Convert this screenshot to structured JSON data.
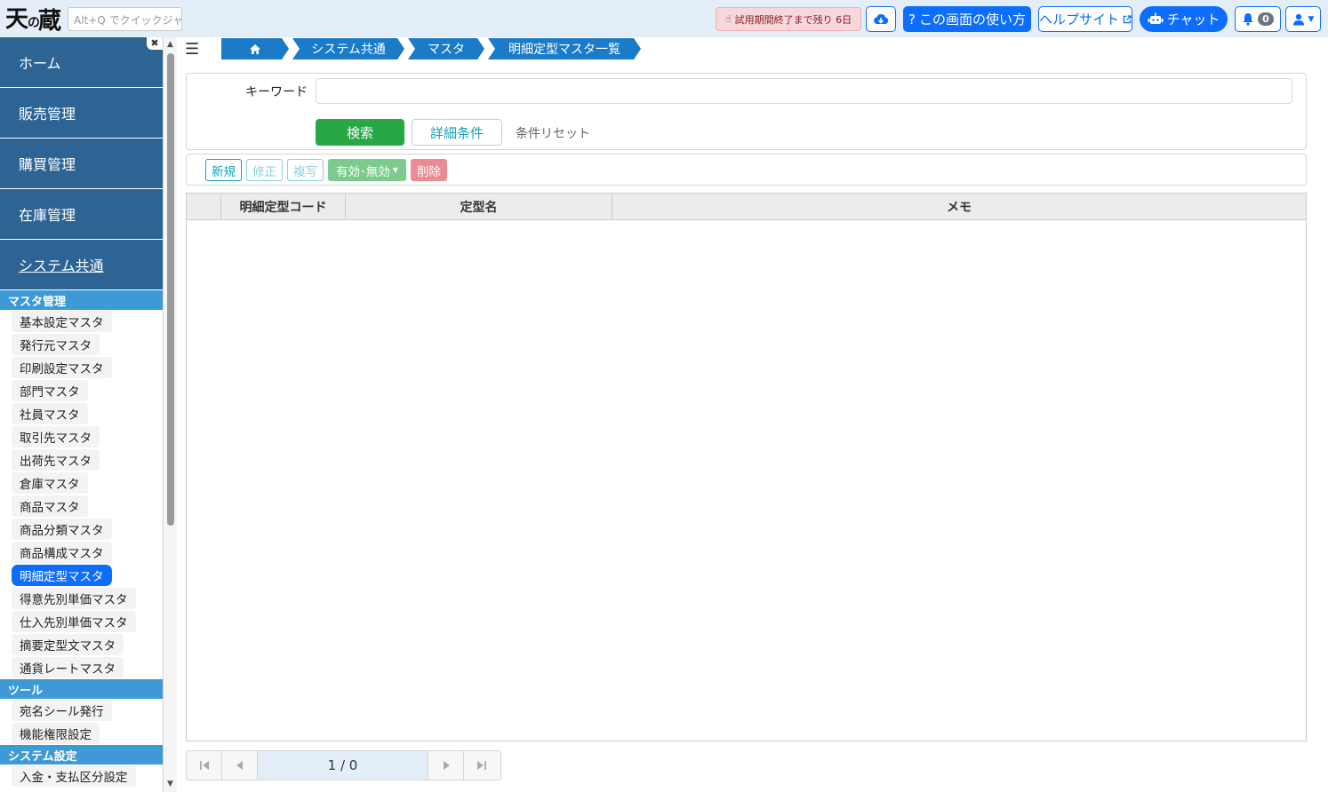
{
  "header": {
    "logo_text": "天の蔵",
    "quickjump_placeholder": "Alt+Q でクイックジャンプ",
    "trial_text": "試用期間終了まで残り 6日",
    "howto_label": "この画面の使い方",
    "help_label": "ヘルプサイト",
    "chat_label": "チャット",
    "notification_count": "0"
  },
  "sidebar": {
    "main_items": [
      {
        "label": "ホーム"
      },
      {
        "label": "販売管理"
      },
      {
        "label": "購買管理"
      },
      {
        "label": "在庫管理"
      },
      {
        "label": "システム共通"
      }
    ],
    "sections": [
      {
        "title": "マスタ管理",
        "items": [
          "基本設定マスタ",
          "発行元マスタ",
          "印刷設定マスタ",
          "部門マスタ",
          "社員マスタ",
          "取引先マスタ",
          "出荷先マスタ",
          "倉庫マスタ",
          "商品マスタ",
          "商品分類マスタ",
          "商品構成マスタ",
          "明細定型マスタ",
          "得意先別単価マスタ",
          "仕入先別単価マスタ",
          "摘要定型文マスタ",
          "通貨レートマスタ"
        ]
      },
      {
        "title": "ツール",
        "items": [
          "宛名シール発行",
          "機能権限設定"
        ]
      },
      {
        "title": "システム設定",
        "items": [
          "入金・支払区分設定"
        ]
      }
    ]
  },
  "breadcrumb": [
    "システム共通",
    "マスタ",
    "明細定型マスタ一覧"
  ],
  "search": {
    "keyword_label": "キーワード",
    "keyword_value": "",
    "search_label": "検索",
    "detail_label": "詳細条件",
    "reset_label": "条件リセット"
  },
  "toolbar": {
    "new_label": "新規",
    "edit_label": "修正",
    "copy_label": "複写",
    "toggle_label": "有効･無効",
    "delete_label": "削除"
  },
  "table": {
    "columns": [
      "",
      "明細定型コード",
      "定型名",
      "メモ"
    ],
    "rows": []
  },
  "pager": {
    "info": "1 / 0"
  },
  "colors": {
    "header_bg": "#e3eef8",
    "sidebar_main": "#2d6494",
    "sidebar_section": "#3d9ad6",
    "breadcrumb": "#1a7bc9",
    "primary": "#0d6efd",
    "search_green": "#28a745"
  }
}
